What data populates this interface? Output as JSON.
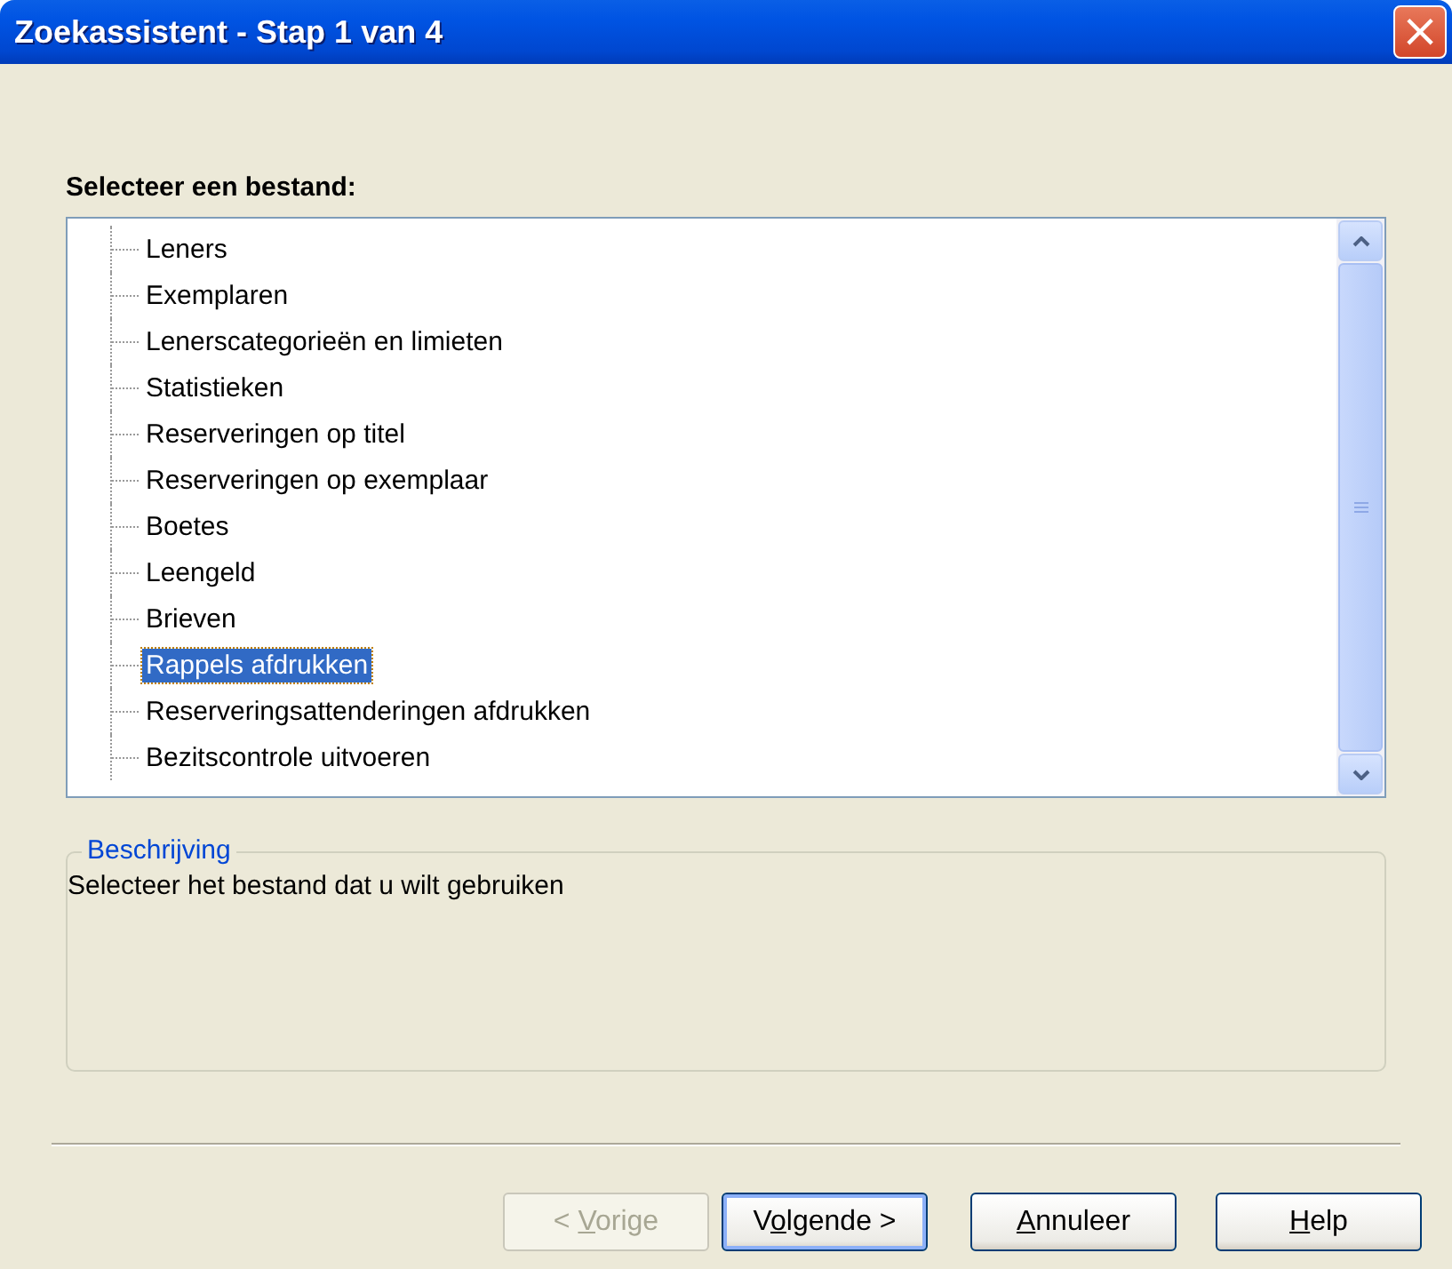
{
  "window": {
    "title": "Zoekassistent - Stap 1 van 4",
    "close": "×"
  },
  "prompt": "Selecteer een bestand:",
  "tree": {
    "items": [
      {
        "label": "Leners",
        "selected": false
      },
      {
        "label": "Exemplaren",
        "selected": false
      },
      {
        "label": "Lenerscategorieën en limieten",
        "selected": false
      },
      {
        "label": "Statistieken",
        "selected": false
      },
      {
        "label": "Reserveringen op titel",
        "selected": false
      },
      {
        "label": "Reserveringen op exemplaar",
        "selected": false
      },
      {
        "label": "Boetes",
        "selected": false
      },
      {
        "label": "Leengeld",
        "selected": false
      },
      {
        "label": "Brieven",
        "selected": false
      },
      {
        "label": "Rappels afdrukken",
        "selected": true
      },
      {
        "label": "Reserveringsattenderingen afdrukken",
        "selected": false
      },
      {
        "label": "Bezitscontrole uitvoeren",
        "selected": false
      }
    ]
  },
  "description": {
    "legend": "Beschrijving",
    "text": "Selecteer het bestand dat u wilt gebruiken"
  },
  "buttons": [
    {
      "before": "< ",
      "accel": "V",
      "after": "orige",
      "disabled": true,
      "default": false
    },
    {
      "before": "V",
      "accel": "o",
      "after": "lgende >",
      "disabled": false,
      "default": true
    },
    {
      "accel": "A",
      "after": "nnuleer",
      "disabled": false,
      "default": false
    },
    {
      "accel": "H",
      "after": "elp",
      "disabled": false,
      "default": false
    }
  ]
}
